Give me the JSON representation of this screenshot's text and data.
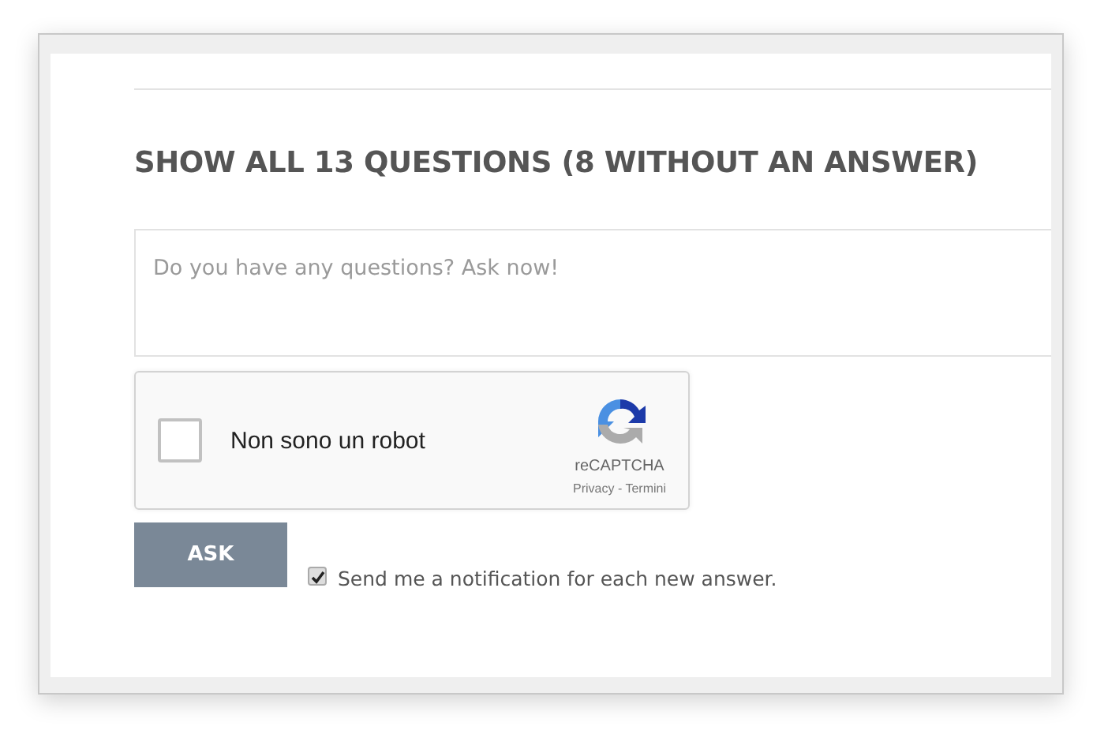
{
  "heading": "SHOW ALL 13 QUESTIONS (8 WITHOUT AN ANSWER)",
  "question_field": {
    "placeholder": "Do you have any questions? Ask now!"
  },
  "captcha": {
    "label": "Non sono un robot",
    "checked": false,
    "brand": "reCAPTCHA",
    "links": "Privacy - Termini"
  },
  "ask_button": "ASK",
  "notify": {
    "label": "Send me a notification for each new answer.",
    "checked": true
  }
}
